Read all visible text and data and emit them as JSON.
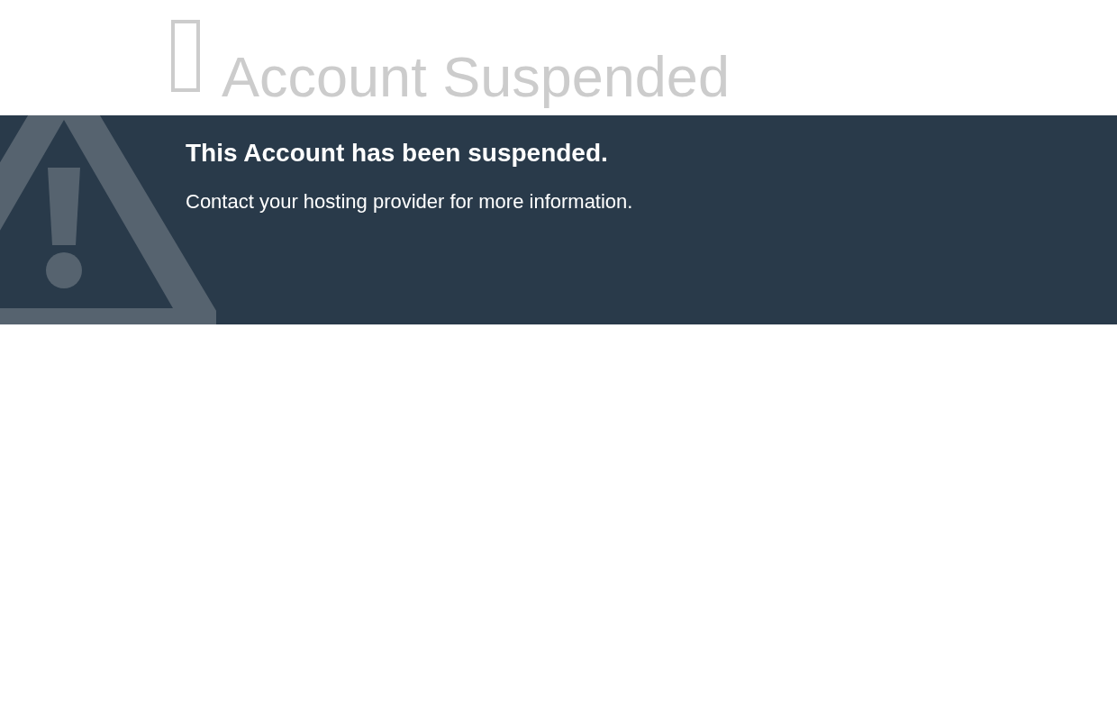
{
  "header": {
    "title": "Account Suspended"
  },
  "notice": {
    "heading": "This Account has been suspended.",
    "message": "Contact your hosting provider for more information."
  }
}
